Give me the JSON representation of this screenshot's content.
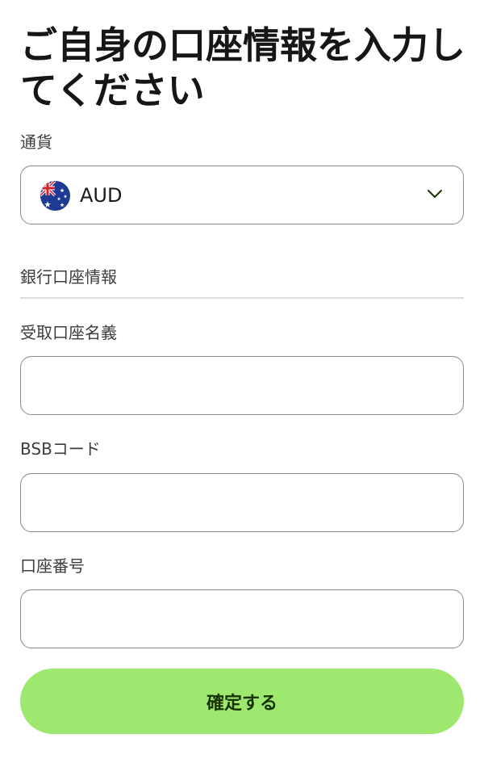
{
  "header": {
    "title": "ご自身の口座情報を入力してください"
  },
  "currency": {
    "label": "通貨",
    "selected_code": "AUD",
    "flag_icon": "australia-flag-icon",
    "dropdown_icon": "chevron-down-icon"
  },
  "bank_section": {
    "heading": "銀行口座情報"
  },
  "fields": {
    "account_holder": {
      "label": "受取口座名義",
      "value": "",
      "placeholder": ""
    },
    "bsb_code": {
      "label": "BSBコード",
      "value": "",
      "placeholder": ""
    },
    "account_number": {
      "label": "口座番号",
      "value": "",
      "placeholder": ""
    }
  },
  "actions": {
    "confirm_label": "確定する"
  },
  "colors": {
    "primary_button": "#9ee870",
    "primary_button_text": "#163300",
    "border": "#8a8a8a",
    "divider": "#dedede"
  }
}
